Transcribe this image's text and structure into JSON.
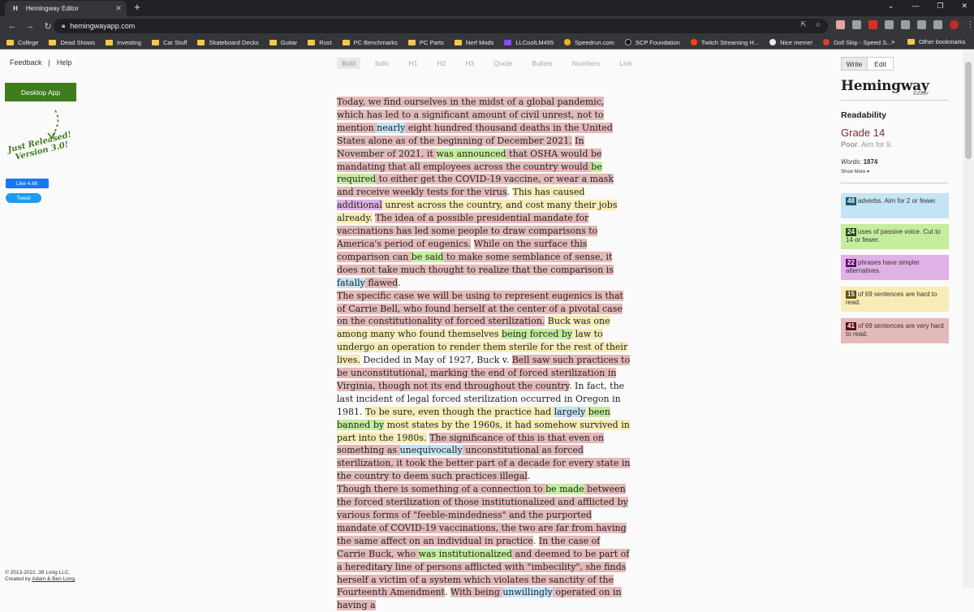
{
  "browser": {
    "tab_title": "Hemingway Editor",
    "url": "hemingwayapp.com",
    "bookmarks": [
      "College",
      "Dead Shows",
      "Investing",
      "Car Stuff",
      "Skateboard Decks",
      "Guitar",
      "Rust",
      "PC Benchmarks",
      "PC Parts",
      "Nerf Mods",
      "LLCoolLM495",
      "Speedrun.com",
      "SCP Foundation",
      "Twitch Streaming H...",
      "Nice meme!",
      "Doll Skip - Speed S..."
    ],
    "bookmarks_more": "»",
    "other_bookmarks": "Other bookmarks"
  },
  "left": {
    "feedback": "Feedback",
    "separator": "|",
    "help": "Help",
    "desktop_app": "Desktop App",
    "just_released_1": "Just Released!",
    "just_released_2": "Version 3.0!",
    "fb_like": "Like 4.6K",
    "tweet": "Tweet",
    "copyright": "© 2013-2021 .38 Long LLC.",
    "created_by_prefix": "Created by ",
    "created_by_link": "Adam & Ben Long",
    "created_by_suffix": "."
  },
  "toolbar": [
    "Bold",
    "Italic",
    "H1",
    "H2",
    "H3",
    "Quote",
    "Bullets",
    "Numbers",
    "Link"
  ],
  "sidebar": {
    "write": "Write",
    "edit": "Edit",
    "logo": "Hemingway",
    "logo_sub": "Editor",
    "readability_title": "Readability",
    "grade": "Grade 14",
    "aim_prefix": "Poor",
    "aim_suffix": ". Aim for 9.",
    "words_label": "Words",
    "words_value": "1874",
    "show_more": "Show More ▾",
    "cards": {
      "adverbs": {
        "count": "48",
        "text": "adverbs. Aim for 2 or fewer."
      },
      "passive": {
        "count": "24",
        "text": "uses of passive voice. Cut to 14 or fewer."
      },
      "phrases": {
        "count": "22",
        "text": "phrases have simpler alternatives."
      },
      "hard": {
        "count": "15",
        "text": "of 69 sentences are hard to read."
      },
      "very_hard": {
        "count": "41",
        "text": "of 69 sentences are very hard to read."
      }
    }
  },
  "editor": {
    "p1": [
      {
        "t": "Today, we find ourselves in the midst of a global pandemic, which has led to a significant amount of civil unrest, not to mention ",
        "c": "red"
      },
      {
        "t": "nearly",
        "c": "blue"
      },
      {
        "t": " eight hundred thousand deaths in the United States alone as of the beginning of December 2021.",
        "c": "red"
      },
      {
        "t": "  ",
        "c": ""
      },
      {
        "t": "In November of 2021, it ",
        "c": "red"
      },
      {
        "t": "was announced",
        "c": "green"
      },
      {
        "t": " that OSHA would be mandating that all employees across the country would ",
        "c": "red"
      },
      {
        "t": "be required",
        "c": "green"
      },
      {
        "t": " to either get the COVID-19 vaccine, or wear a mask and receive weekly tests for the virus",
        "c": "red"
      },
      {
        "t": ".  ",
        "c": ""
      },
      {
        "t": "This has caused ",
        "c": "yellow"
      },
      {
        "t": "additional",
        "c": "purple"
      },
      {
        "t": " unrest across the country, and cost many their jobs already.",
        "c": "yellow"
      },
      {
        "t": "  ",
        "c": ""
      },
      {
        "t": "The idea of a possible presidential mandate for vaccinations has led some people to draw comparisons to America's period of eugenics.",
        "c": "red"
      },
      {
        "t": "  ",
        "c": ""
      },
      {
        "t": "While on the surface this comparison can ",
        "c": "red"
      },
      {
        "t": "be said",
        "c": "green"
      },
      {
        "t": " to make some semblance of sense, it does not take much thought to realize that the comparison is ",
        "c": "red"
      },
      {
        "t": "fatally",
        "c": "blue"
      },
      {
        "t": " flawed",
        "c": "red"
      },
      {
        "t": ".",
        "c": ""
      }
    ],
    "p2": [
      {
        "t": "        The specific case we will be using to represent eugenics is that of Carrie Bell, who found herself at the center of a pivotal case on the constitutionality of forced sterilization.",
        "c": "red"
      },
      {
        "t": "  ",
        "c": ""
      },
      {
        "t": "Buck was one among many who found themselves ",
        "c": "yellow"
      },
      {
        "t": "being forced by",
        "c": "green"
      },
      {
        "t": " law to undergo an operation to render them sterile for the rest of their lives.",
        "c": "yellow"
      },
      {
        "t": "  Decided in May of 1927, Buck v. ",
        "c": ""
      },
      {
        "t": "Bell saw such practices to be unconstitutional, marking the end of forced sterilization in Virginia, though not its end throughout the country",
        "c": "red"
      },
      {
        "t": ".  In fact, the last incident of legal forced sterilization occurred in Oregon in 1981.  ",
        "c": ""
      },
      {
        "t": "To be sure, even though the practice had ",
        "c": "yellow"
      },
      {
        "t": "largely",
        "c": "blue"
      },
      {
        "t": " ",
        "c": "yellow"
      },
      {
        "t": "been banned by",
        "c": "green"
      },
      {
        "t": " most states by the 1960s, it had somehow survived in part into the 1980s.",
        "c": "yellow"
      },
      {
        "t": "  ",
        "c": ""
      },
      {
        "t": "The significance of this is that even on something as ",
        "c": "red"
      },
      {
        "t": "unequivocally",
        "c": "blue"
      },
      {
        "t": " unconstitutional as forced sterilization, it took the better part of a decade for every state in the country to deem such practices illegal",
        "c": "red"
      },
      {
        "t": ".",
        "c": ""
      }
    ],
    "p3": [
      {
        "t": "Though there is something of a connection to ",
        "c": "red"
      },
      {
        "t": "be made",
        "c": "green"
      },
      {
        "t": " between the forced sterilization of those institutionalized and afflicted by various forms of \"feeble-mindedness\" and the purported mandate of COVID-19 vaccinations, the two are far from having the same affect on an individual in practice",
        "c": "red"
      },
      {
        "t": ".  ",
        "c": ""
      },
      {
        "t": "In the case of Carrie Buck, who ",
        "c": "red"
      },
      {
        "t": "was institutionalized",
        "c": "green"
      },
      {
        "t": " and deemed to be part of a hereditary line of persons afflicted with \"imbecility\", she finds herself a victim of a system which violates the sanctity of the Fourteenth Amendment",
        "c": "red"
      },
      {
        "t": ".  ",
        "c": ""
      },
      {
        "t": "With being ",
        "c": "red"
      },
      {
        "t": "unwillingly",
        "c": "blue"
      },
      {
        "t": " operated on in having a",
        "c": "red"
      }
    ]
  }
}
